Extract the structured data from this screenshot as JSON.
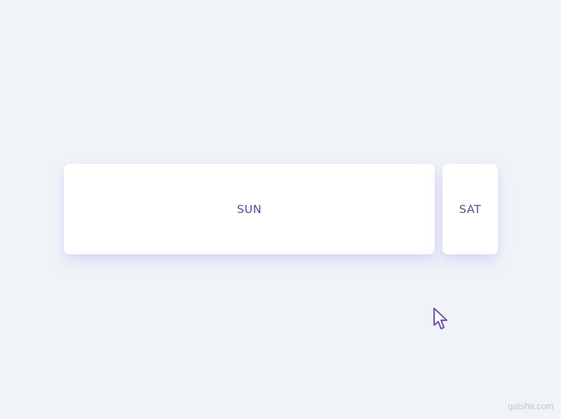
{
  "days": {
    "sun": {
      "label": "SUN"
    },
    "sat": {
      "label": "SAT"
    }
  },
  "cursor": {
    "icon": "pointer-cursor-icon"
  },
  "watermark": {
    "text": "galshir.com"
  },
  "colors": {
    "background": "#f0f4f8",
    "card": "#ffffff",
    "label": "#5b4a8e",
    "accent": "#6b4fa8",
    "watermark": "#c3c8d0"
  }
}
